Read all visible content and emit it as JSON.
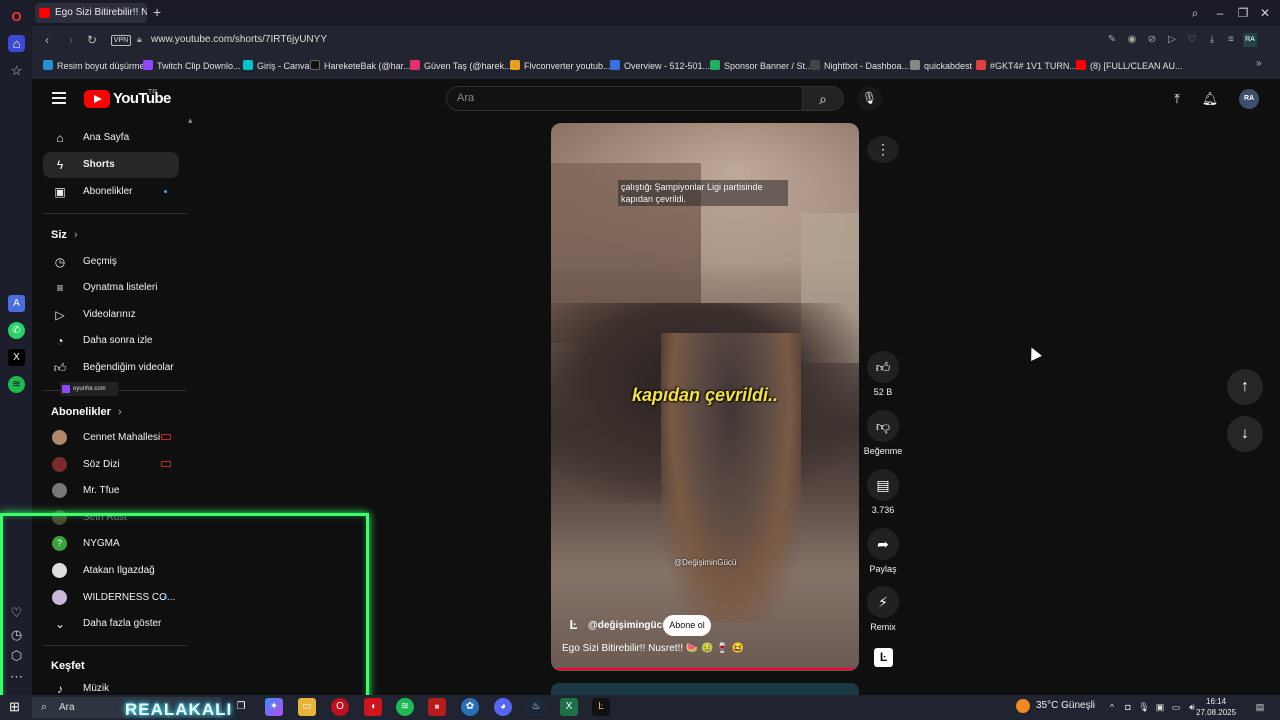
{
  "browser": {
    "tab_title": "Ego Sizi Bitirebilir!! Nu",
    "url": "www.youtube.com/shorts/7IRT6jyUNYY",
    "vpn_label": "VPN",
    "bookmarks": [
      {
        "label": "Resim boyut düşürme",
        "color": "#2b8fd6"
      },
      {
        "label": "Twitch Clip Downlo...",
        "color": "#9146ff"
      },
      {
        "label": "Giriş - Canva",
        "color": "#00c4cc"
      },
      {
        "label": "HareketeBak (@har...",
        "color": "#111111"
      },
      {
        "label": "Güven Taş (@harek...",
        "color": "#e1306c"
      },
      {
        "label": "Flvconverter youtub...",
        "color": "#e8a020"
      },
      {
        "label": "Overview - 512-501...",
        "color": "#3a6fe0"
      },
      {
        "label": "Sponsor Banner / St...",
        "color": "#20b060"
      },
      {
        "label": "Nightbot - Dashboa...",
        "color": "#444444"
      },
      {
        "label": "quickabdest",
        "color": "#888888"
      },
      {
        "label": "#GKT4# 1V1 TURN...",
        "color": "#e04040"
      },
      {
        "label": "(8) [FULL/CLEAN AU...",
        "color": "#ff0000"
      }
    ]
  },
  "youtube": {
    "logo_text": "YouTube",
    "region": "TR",
    "search_placeholder": "Ara",
    "avatar_text": "RA",
    "sidebar": {
      "main": [
        {
          "label": "Ana Sayfa",
          "icon": "home-icon"
        },
        {
          "label": "Shorts",
          "icon": "shorts-icon"
        },
        {
          "label": "Abonelikler",
          "icon": "subscriptions-icon"
        }
      ],
      "you_heading": "Siz",
      "you": [
        {
          "label": "Geçmiş",
          "icon": "history-icon"
        },
        {
          "label": "Oynatma listeleri",
          "icon": "playlist-icon"
        },
        {
          "label": "Videolarınız",
          "icon": "your-videos-icon"
        },
        {
          "label": "Daha sonra izle",
          "icon": "watch-later-icon"
        },
        {
          "label": "Beğendiğim videolar",
          "icon": "liked-videos-icon"
        }
      ],
      "subs_heading": "Abonelikler",
      "subscriptions": [
        {
          "label": "Cennet Mahallesi",
          "color": "#b0876a"
        },
        {
          "label": "Söz Dizi",
          "color": "#7a2a2a"
        },
        {
          "label": "Mr. Tfue",
          "color": "#777777"
        },
        {
          "label": "Seth Rust",
          "color": "#8a9a5a"
        },
        {
          "label": "NYGMA",
          "color": "#3aa33a"
        },
        {
          "label": "Atakan Ilgazdağ",
          "color": "#dddddd"
        },
        {
          "label": "WILDERNESS CO...",
          "color": "#c9b8d8"
        }
      ],
      "show_more": "Daha fazla göster",
      "explore_heading": "Keşfet",
      "explore": [
        {
          "label": "Müzik"
        }
      ]
    },
    "short": {
      "caption_top": "çalıştığı Şampiyonlar Ligi partisinde kapıdan çevrildi.",
      "caption_big": "kapıdan çevrildi..",
      "watermark": "@DeğişiminGücü",
      "channel": "@değişimingücü",
      "subscribe": "Abone ol",
      "title": "Ego Sizi Bitirebilir!! Nusret!! 🍉 🤢 🍷 😆",
      "actions": {
        "like_count": "52 B",
        "dislike_label": "Beğenme",
        "comment_count": "3.736",
        "share_label": "Paylaş",
        "remix_label": "Remix"
      }
    }
  },
  "overlay": {
    "twitch_tag": "oyunfor.com",
    "cam_text": "REALAKALI"
  },
  "taskbar": {
    "search_placeholder": "Ara",
    "weather": "35°C  Güneşli",
    "time": "16:14",
    "date": "27.08.2025"
  }
}
